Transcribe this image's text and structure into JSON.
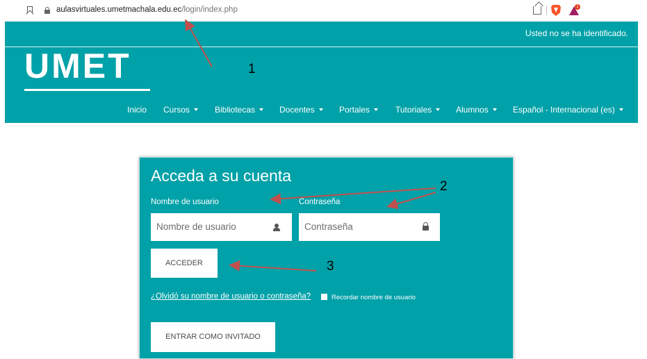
{
  "browser": {
    "url_domain": "aulasvirtuales.umetmachala.edu.ec",
    "url_path": "/login/index.php",
    "rewards_badge": "1"
  },
  "header": {
    "login_status": "Usted no se ha identificado.",
    "logo_text": "UMET",
    "nav": [
      {
        "label": "Inicio",
        "dropdown": false
      },
      {
        "label": "Cursos",
        "dropdown": true
      },
      {
        "label": "Bibliotecas",
        "dropdown": true
      },
      {
        "label": "Docentes",
        "dropdown": true
      },
      {
        "label": "Portales",
        "dropdown": true
      },
      {
        "label": "Tutoriales",
        "dropdown": true
      },
      {
        "label": "Alumnos",
        "dropdown": true
      },
      {
        "label": "Español - Internacional (es)",
        "dropdown": true
      }
    ]
  },
  "login": {
    "title": "Acceda a su cuenta",
    "username_label": "Nombre de usuario",
    "username_placeholder": "Nombre de usuario",
    "password_label": "Contraseña",
    "password_placeholder": "Contraseña",
    "submit_label": "ACCEDER",
    "forgot_link": "¿Olvidó su nombre de usuario o contraseña?",
    "remember_label": "Recordar nombre de usuario",
    "remember_checked": false,
    "guest_label": "ENTRAR COMO INVITADO"
  },
  "annotations": {
    "numbers": [
      "1",
      "2",
      "3"
    ],
    "color": "#c0504d"
  },
  "colors": {
    "brand_teal": "#00a1a8",
    "text_white": "#ffffff"
  }
}
